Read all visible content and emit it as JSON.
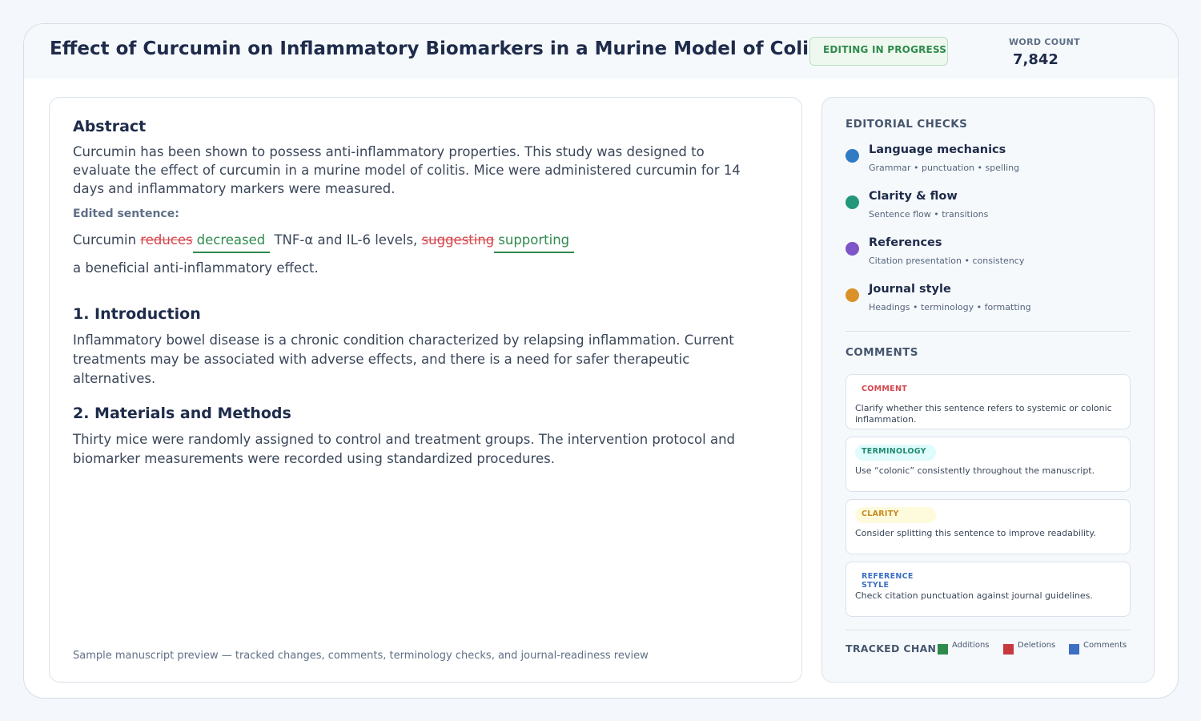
{
  "header": {
    "title": "Effect of Curcumin on Inflammatory Biomarkers in a Murine Model of Colitis",
    "status": "EDITING IN PROGRESS",
    "word_count_label": "WORD COUNT",
    "word_count": "7,842"
  },
  "document": {
    "abstract_heading": "Abstract",
    "abstract_text": "Curcumin has been shown to possess anti-inflammatory properties. This study was designed to evaluate the effect of curcumin in a murine model of colitis. Mice were administered curcumin for 14 days and inflammatory markers were measured.",
    "edited_label": "Edited sentence:",
    "edit": {
      "lead": "Curcumin ",
      "deleted_1": "reduces",
      "inserted_1": "decreased",
      "middle": " TNF-α and IL-6 levels, ",
      "deleted_2": "suggesting",
      "inserted_2": "supporting",
      "continuation": "a beneficial anti-inflammatory effect."
    },
    "intro_heading": "1. Introduction",
    "intro_text": "Inflammatory bowel disease is a chronic condition characterized by relapsing inflammation. Current treatments may be associated with adverse effects, and there is a need for safer therapeutic alternatives.",
    "methods_heading": "2. Materials and Methods",
    "methods_text": "Thirty mice were randomly assigned to control and treatment groups. The intervention protocol and biomarker measurements were recorded using standardized procedures.",
    "footnote": "Sample manuscript preview — tracked changes, comments, terminology checks, and journal-readiness review"
  },
  "sidebar": {
    "checks_heading": "EDITORIAL CHECKS",
    "checks": [
      {
        "title": "Language mechanics",
        "subtitle": "Grammar • punctuation • spelling",
        "color": "#2f7bc4"
      },
      {
        "title": "Clarity & flow",
        "subtitle": "Sentence flow • transitions",
        "color": "#23977a"
      },
      {
        "title": "References",
        "subtitle": "Citation presentation • consistency",
        "color": "#7e55c8"
      },
      {
        "title": "Journal style",
        "subtitle": "Headings • terminology • formatting",
        "color": "#dc9128"
      }
    ],
    "comments_heading": "COMMENTS",
    "comments": [
      {
        "tag": "COMMENT",
        "text": "Clarify whether this sentence refers to systemic or colonic inflammation.",
        "tag_color": "#d4464c",
        "tag_bg": "#ffffff"
      },
      {
        "tag": "TERMINOLOGY",
        "text": "Use “colonic” consistently throughout the manuscript.",
        "tag_color": "#218a73",
        "tag_bg": "#dffbfb"
      },
      {
        "tag": "CLARITY",
        "text": "Consider splitting this sentence to improve readability.",
        "tag_color": "#c88a20",
        "tag_bg": "#fdfbdc"
      },
      {
        "tag": "REFERENCE STYLE",
        "text": "Check citation punctuation against journal guidelines.",
        "tag_color": "#3d6fc2",
        "tag_bg": "#ffffff"
      }
    ],
    "tracked_label": "TRACKED CHANGES",
    "legend": [
      {
        "label": "Additions",
        "color": "#2f8a4d"
      },
      {
        "label": "Deletions",
        "color": "#c8383f"
      },
      {
        "label": "Comments",
        "color": "#3d6fc2"
      }
    ]
  }
}
